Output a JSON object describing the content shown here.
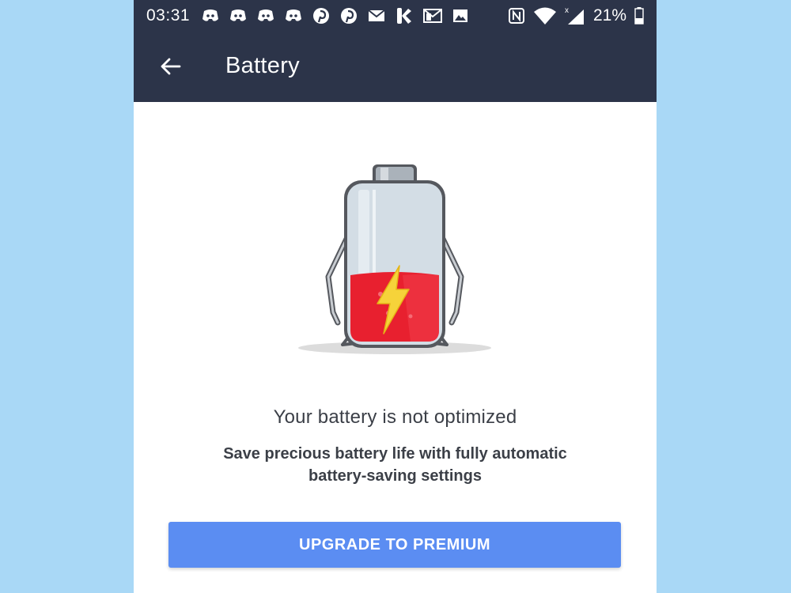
{
  "status_bar": {
    "time": "03:31",
    "battery_percent": "21%",
    "notification_icons": [
      "discord-icon",
      "discord-icon",
      "discord-icon",
      "discord-icon",
      "pinterest-icon",
      "pinterest-icon",
      "mail-icon",
      "kik-icon",
      "gmail-icon",
      "image-icon"
    ],
    "system_icons": [
      "nfc-icon",
      "wifi-icon",
      "signal-icon",
      "battery-icon"
    ]
  },
  "app_bar": {
    "title": "Battery"
  },
  "main": {
    "headline": "Your battery is not optimized",
    "description": "Save precious battery life with fully automatic battery-saving settings",
    "cta_label": "UPGRADE TO PREMIUM"
  },
  "colors": {
    "header_bg": "#2c3449",
    "button_bg": "#5b8df2",
    "page_bg": "#a9d8f6",
    "battery_fill": "#e8202f",
    "bolt": "#f6d33a"
  }
}
